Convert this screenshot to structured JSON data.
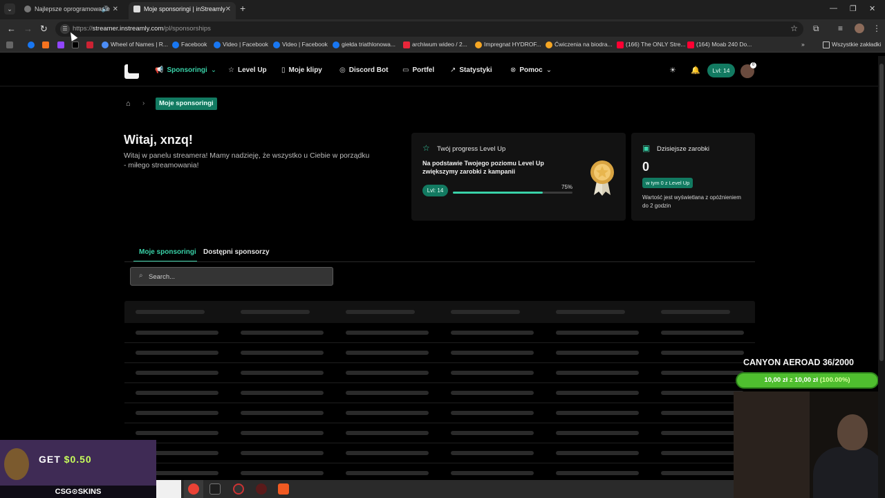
{
  "browser": {
    "tabs": [
      {
        "title": "Najlepsze oprogramowanie",
        "active": false,
        "audio": true
      },
      {
        "title": "Moje sponsoringi | inStreamly",
        "active": true
      }
    ],
    "url_prefix": "https://",
    "url_host": "streamer.instreamly.com",
    "url_path": "/pl/sponsorships",
    "bookmarks": [
      {
        "label": "Wheel of Names | R...",
        "color": "#4c8df6"
      },
      {
        "label": "Facebook",
        "color": "#1877f2"
      },
      {
        "label": "Video | Facebook",
        "color": "#1877f2"
      },
      {
        "label": "Video | Facebook",
        "color": "#1877f2"
      },
      {
        "label": "giełda triathlonowa...",
        "color": "#1877f2"
      },
      {
        "label": "archiwum wideo / 2...",
        "color": "#e8263a"
      },
      {
        "label": "Impregnat HYDROF...",
        "color": "#f5a623"
      },
      {
        "label": "Ćwiczenia na biodra...",
        "color": "#f5a623"
      },
      {
        "label": "(166) The ONLY Stre...",
        "color": "#ff0033"
      },
      {
        "label": "(164) Moab 240 Do...",
        "color": "#ff0033"
      }
    ],
    "all_bookmarks": "Wszystkie zakładki"
  },
  "header": {
    "nav": [
      {
        "label": "Sponsoringi",
        "icon": "megaphone-icon",
        "active": true,
        "dropdown": true
      },
      {
        "label": "Level Up",
        "icon": "star-icon"
      },
      {
        "label": "Moje klipy",
        "icon": "clip-icon"
      },
      {
        "label": "Discord Bot",
        "icon": "discord-icon"
      },
      {
        "label": "Portfel",
        "icon": "wallet-icon"
      },
      {
        "label": "Statystyki",
        "icon": "chart-icon"
      },
      {
        "label": "Pomoc",
        "icon": "help-icon",
        "dropdown": true
      }
    ],
    "level_pill": "Lvl: 14",
    "accent": "#39d2a8"
  },
  "breadcrumb": {
    "current": "Moje sponsoringi"
  },
  "welcome": {
    "title": "Witaj, xnzq!",
    "text": "Witaj w panelu streamera! Mamy nadzieję, że wszystko u Ciebie w porządku - miłego streamowania!"
  },
  "levelup_card": {
    "title": "Twój progress Level Up",
    "desc": "Na podstawie Twojego poziomu Level Up zwiększymy zarobki z kampanii",
    "level": "Lvl: 14",
    "progress": 0.75,
    "progress_label": "75%"
  },
  "earnings_card": {
    "title": "Dzisiejsze zarobki",
    "value": "0",
    "badge": "w tym 0 z Level Up",
    "note": "Wartość jest wyświetlana z opóźnieniem do 2 godzin"
  },
  "page_tabs": [
    {
      "label": "Moje sponsoringi",
      "active": true
    },
    {
      "label": "Dostępni sponsorzy",
      "active": false
    }
  ],
  "search": {
    "placeholder": "Search..."
  },
  "overlay": {
    "goal_title": "CANYON AEROAD 36/2000",
    "goal_current": "10,00 zł",
    "goal_sep": "z",
    "goal_target": "10,00 zł",
    "goal_pct": "(100.00%)",
    "goal_progress": 1.0,
    "promo_get": "GET",
    "promo_amount": "$0.50",
    "promo_brand": "CSG⊙SKINS"
  }
}
